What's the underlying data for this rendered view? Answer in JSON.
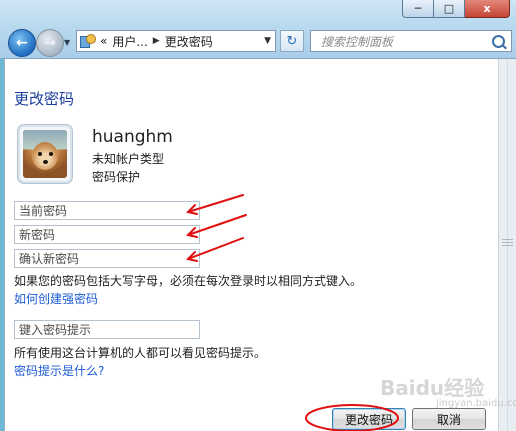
{
  "window": {
    "minimize_icon": "minimize-icon",
    "maximize_icon": "maximize-icon",
    "close_glyph": "x"
  },
  "address_bar": {
    "prefix": "«",
    "crumbs": [
      "用户...",
      "更改密码"
    ]
  },
  "search": {
    "placeholder": "搜索控制面板"
  },
  "page": {
    "title": "更改密码",
    "username": "huanghm",
    "account_type": "未知帐户类型",
    "password_status": "密码保护"
  },
  "form": {
    "current_password_placeholder": "当前密码",
    "new_password_placeholder": "新密码",
    "confirm_password_placeholder": "确认新密码",
    "caps_note": "如果您的密码包括大写字母，必须在每次登录时以相同方式键入。",
    "strong_password_link": "如何创建强密码",
    "hint_placeholder": "键入密码提示",
    "hint_note": "所有使用这台计算机的人都可以看见密码提示。",
    "hint_link": "密码提示是什么?"
  },
  "buttons": {
    "ok": "更改密码",
    "cancel": "取消"
  },
  "annotation_color": "#e01010",
  "watermark": {
    "text": "Baidu经验",
    "sub": "jingyan.baidu.com"
  }
}
